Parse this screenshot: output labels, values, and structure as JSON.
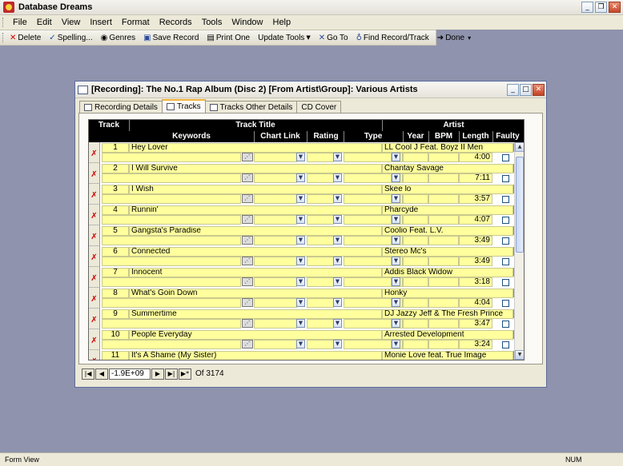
{
  "app": {
    "title": "Database Dreams"
  },
  "menu": [
    "File",
    "Edit",
    "View",
    "Insert",
    "Format",
    "Records",
    "Tools",
    "Window",
    "Help"
  ],
  "toolbar": [
    {
      "label": "Delete",
      "icon": "delete-icon"
    },
    {
      "label": "Spelling...",
      "icon": "spelling-icon"
    },
    {
      "label": "Genres",
      "icon": "genres-icon"
    },
    {
      "label": "Save Record",
      "icon": "save-icon"
    },
    {
      "label": "Print One",
      "icon": "print-icon"
    },
    {
      "label": "Update Tools",
      "icon": "dropdown-icon"
    },
    {
      "label": "Go To",
      "icon": "goto-icon"
    },
    {
      "label": "Find Record/Track",
      "icon": "binoculars-icon"
    },
    {
      "label": "Done",
      "icon": "done-icon"
    }
  ],
  "document": {
    "title": "[Recording]: The No.1 Rap Album (Disc 2) [From Artist\\Group]: Various Artists",
    "tabs": [
      "Recording Details",
      "Tracks",
      "Tracks Other Details",
      "CD Cover"
    ],
    "active_tab": "Tracks"
  },
  "headers": {
    "row1": {
      "track": "Track",
      "title": "Track Title",
      "artist": "Artist"
    },
    "row2": {
      "keywords": "Keywords",
      "chart_link": "Chart Link",
      "rating": "Rating",
      "type": "Type",
      "year": "Year",
      "bpm": "BPM",
      "length": "Length",
      "faulty": "Faulty"
    }
  },
  "tracks": [
    {
      "num": "1",
      "title": "Hey Lover",
      "artist": "LL Cool J Feat. Boyz II Men",
      "length": "4:00"
    },
    {
      "num": "2",
      "title": "I Will Survive",
      "artist": "Chantay Savage",
      "length": "7:11"
    },
    {
      "num": "3",
      "title": "I Wish",
      "artist": "Skee lo",
      "length": "3:57"
    },
    {
      "num": "4",
      "title": "Runnin'",
      "artist": "Pharcyde",
      "length": "4:07"
    },
    {
      "num": "5",
      "title": "Gangsta's Paradise",
      "artist": "Coolio Feat. L.V.",
      "length": "3:49"
    },
    {
      "num": "6",
      "title": "Connected",
      "artist": "Stereo Mc's",
      "length": "3:49"
    },
    {
      "num": "7",
      "title": "Innocent",
      "artist": "Addis Black Widow",
      "length": "3:18"
    },
    {
      "num": "8",
      "title": "What's Goin Down",
      "artist": "Honky",
      "length": "4:04"
    },
    {
      "num": "9",
      "title": "Summertime",
      "artist": "DJ Jazzy Jeff & The Fresh Prince",
      "length": "3:47"
    },
    {
      "num": "10",
      "title": "People Everyday",
      "artist": "Arrested Development",
      "length": "3:24"
    },
    {
      "num": "11",
      "title": "It's A Shame (My Sister)",
      "artist": "Monie Love feat. True Image",
      "length": ""
    }
  ],
  "navigation": {
    "current": "-1.9E+09",
    "of_label": "Of 3174"
  },
  "status": {
    "left": "Form View",
    "right": "NUM"
  }
}
